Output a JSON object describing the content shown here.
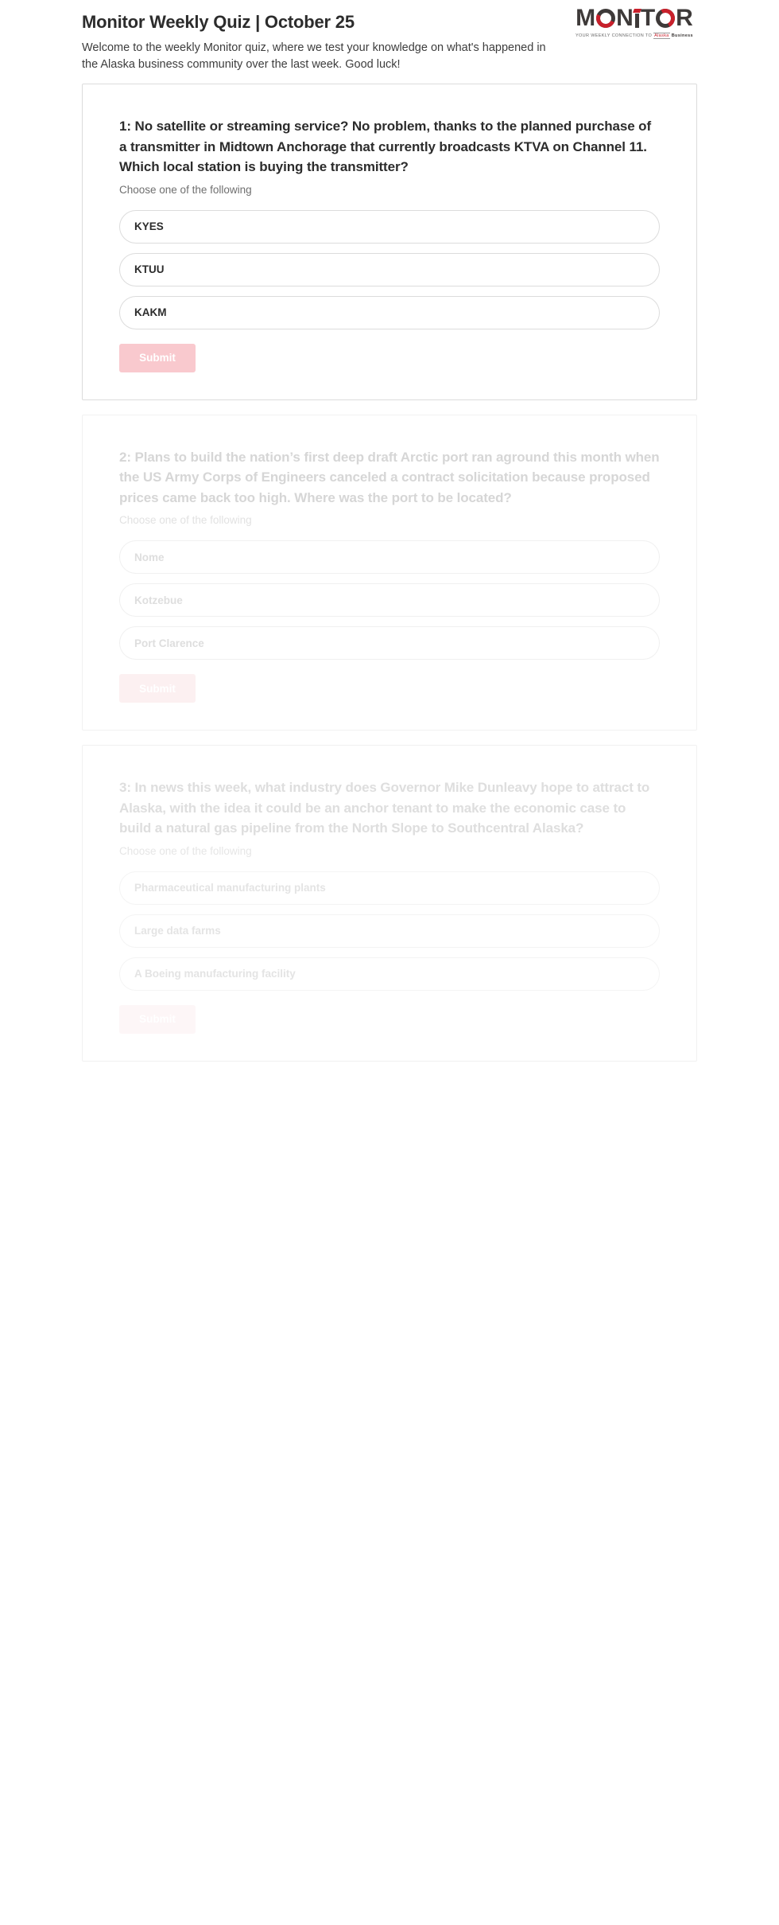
{
  "header": {
    "title": "Monitor Weekly Quiz | October 25",
    "intro": "Welcome to the weekly Monitor quiz, where we test your knowledge on what's happened in the Alaska business community over the last week. Good luck!"
  },
  "logo": {
    "wordmark": "MONITOR",
    "letters": {
      "m": "M",
      "n": "N",
      "t": "T",
      "r": "R"
    },
    "tagline_prefix": "YOUR WEEKLY CONNECTION TO",
    "tagline_brand_1": "Alaska",
    "tagline_brand_2": "Business",
    "colors": {
      "ink": "#3e3a39",
      "accent": "#c8202b"
    }
  },
  "colors": {
    "submit_pink": "#f9c9ce",
    "card_border": "#e4e4e4",
    "title_ink": "#2c2c2c",
    "muted": "#6f6f6f"
  },
  "questions": [
    {
      "title": "1: No satellite or streaming service? No problem, thanks to the planned purchase of a transmitter in Midtown Anchorage that currently broadcasts KTVA on Channel 11. Which local station is buying the transmitter?",
      "subtitle": "Choose one of the following",
      "options": [
        "KYES",
        "KTUU",
        "KAKM"
      ],
      "submit_label": "Submit"
    },
    {
      "title": "2: Plans to build the nation’s first deep draft Arctic port ran aground this month when the US Army Corps of Engineers canceled a contract solicitation because proposed prices came back too high. Where was the port to be located?",
      "subtitle": "Choose one of the following",
      "options": [
        "Nome",
        "Kotzebue",
        "Port Clarence"
      ],
      "submit_label": "Submit"
    },
    {
      "title": "3: In news this week, what industry does Governor Mike Dunleavy hope to attract to Alaska, with the idea it could be an anchor tenant to make the economic case to build a natural gas pipeline from the North Slope to Southcentral Alaska?",
      "subtitle": "Choose one of the following",
      "options": [
        "Pharmaceutical manufacturing plants",
        "Large data farms",
        "A Boeing manufacturing facility"
      ],
      "submit_label": "Submit"
    }
  ]
}
